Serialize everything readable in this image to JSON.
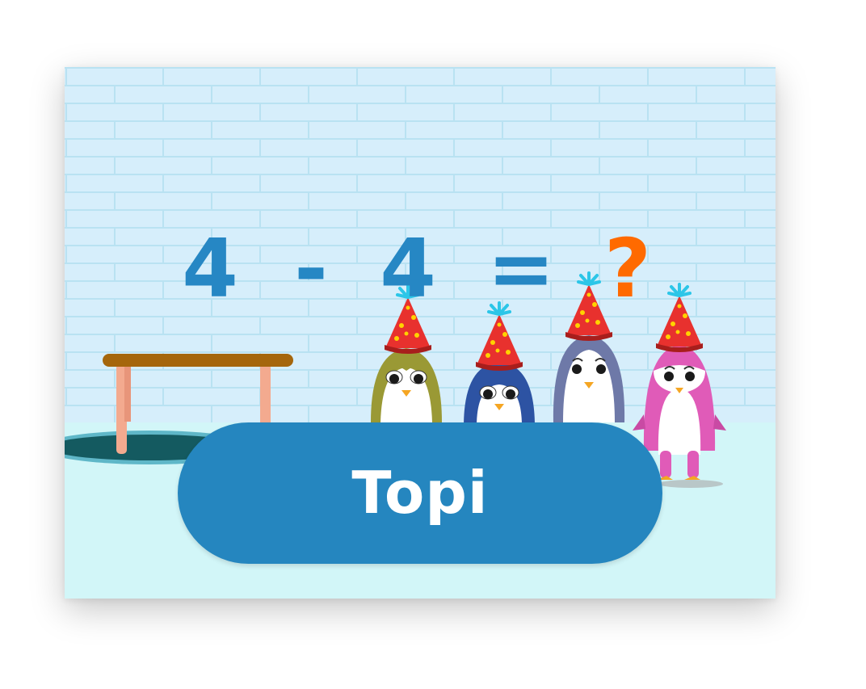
{
  "equation": {
    "operand_a": "4",
    "operator": "-",
    "operand_b": "4",
    "equals": "=",
    "answer": "?"
  },
  "play_button": {
    "label": "Topi"
  },
  "colors": {
    "wall": "#d6eefb",
    "floor": "#d2f6f8",
    "number": "#2687c4",
    "question": "#ff6a00",
    "button": "#2586bf",
    "button_text": "#ffffff",
    "table_top": "#a5660c",
    "table_legs": "#f3aa8f",
    "hole": "#145a60",
    "hat": "#e8312e"
  },
  "characters": [
    {
      "name": "olive-penguin",
      "color": "#9a9935"
    },
    {
      "name": "blue-penguin",
      "color": "#2d53a3"
    },
    {
      "name": "grey-penguin",
      "color": "#6e79a8"
    },
    {
      "name": "pink-penguin",
      "color": "#e05bb8"
    }
  ]
}
